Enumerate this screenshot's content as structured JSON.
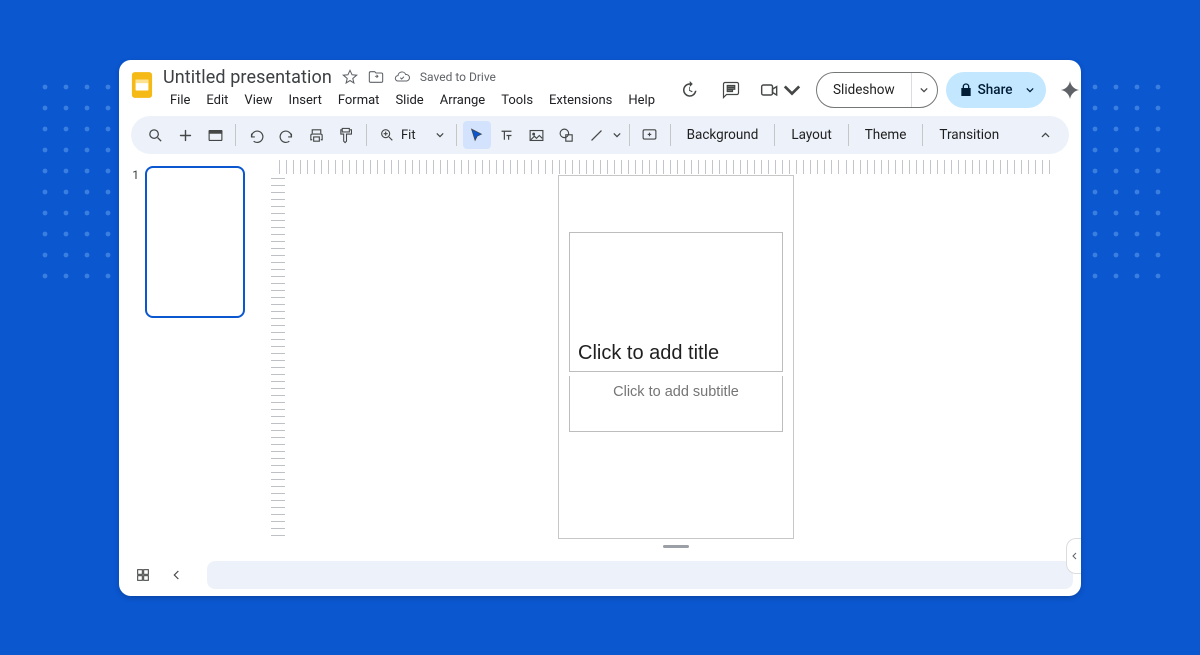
{
  "doc": {
    "title": "Untitled presentation",
    "drive_status": "Saved to Drive"
  },
  "menu": [
    "File",
    "Edit",
    "View",
    "Insert",
    "Format",
    "Slide",
    "Arrange",
    "Tools",
    "Extensions",
    "Help"
  ],
  "header": {
    "slideshow": "Slideshow",
    "share": "Share"
  },
  "toolbar": {
    "zoom_label": "Fit",
    "background": "Background",
    "layout": "Layout",
    "theme": "Theme",
    "transition": "Transition"
  },
  "panel": {
    "slide_number": "1"
  },
  "slide": {
    "title_placeholder": "Click to add title",
    "subtitle_placeholder": "Click to add subtitle"
  }
}
